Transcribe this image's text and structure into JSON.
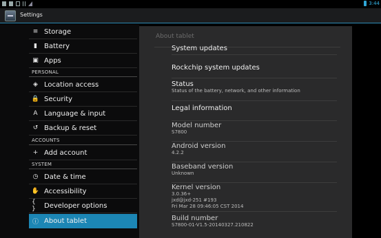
{
  "status_bar": {
    "time": "3:44",
    "icons": [
      "notification-icon",
      "notification-icon",
      "mail-icon",
      "usb-icon",
      "signal-icon"
    ]
  },
  "action_bar": {
    "title": "Settings",
    "icon": "settings-app-icon"
  },
  "sidebar": {
    "items": [
      {
        "label": "Storage",
        "icon": "storage-icon",
        "glyph": "≡"
      },
      {
        "label": "Battery",
        "icon": "battery-icon",
        "glyph": "▮"
      },
      {
        "label": "Apps",
        "icon": "apps-icon",
        "glyph": "▣"
      }
    ],
    "sections": [
      {
        "header": "PERSONAL",
        "items": [
          {
            "label": "Location access",
            "icon": "location-icon",
            "glyph": "◈"
          },
          {
            "label": "Security",
            "icon": "lock-icon",
            "glyph": "🔒"
          },
          {
            "label": "Language & input",
            "icon": "keyboard-icon",
            "glyph": "A"
          },
          {
            "label": "Backup & reset",
            "icon": "backup-icon",
            "glyph": "↺"
          }
        ]
      },
      {
        "header": "ACCOUNTS",
        "items": [
          {
            "label": "Add account",
            "icon": "add-icon",
            "glyph": "+"
          }
        ]
      },
      {
        "header": "SYSTEM",
        "items": [
          {
            "label": "Date & time",
            "icon": "clock-icon",
            "glyph": "◷"
          },
          {
            "label": "Accessibility",
            "icon": "hand-icon",
            "glyph": "✋"
          },
          {
            "label": "Developer options",
            "icon": "braces-icon",
            "glyph": "{ }"
          },
          {
            "label": "About tablet",
            "icon": "info-icon",
            "glyph": "ⓘ",
            "selected": true
          }
        ]
      }
    ]
  },
  "detail": {
    "title": "About tablet",
    "items": [
      {
        "title": "System updates"
      },
      {
        "title": "Rockchip system updates"
      },
      {
        "title": "Status",
        "subtitle": "Status of the battery, network, and other information"
      },
      {
        "title": "Legal information"
      },
      {
        "title": "Model number",
        "subtitle": "S7800"
      },
      {
        "title": "Android version",
        "subtitle": "4.2.2"
      },
      {
        "title": "Baseband version",
        "subtitle": "Unknown"
      },
      {
        "title": "Kernel version",
        "subtitle_lines": [
          "3.0.36+",
          "jxd@jxd-251 #193",
          "Fri Mar 28 09:46:05 CST 2014"
        ]
      },
      {
        "title": "Build number",
        "subtitle": "S7800-01-V1.5-20140327.210822"
      }
    ]
  },
  "colors": {
    "accent": "#1c86b5",
    "time": "#35b3e6"
  }
}
